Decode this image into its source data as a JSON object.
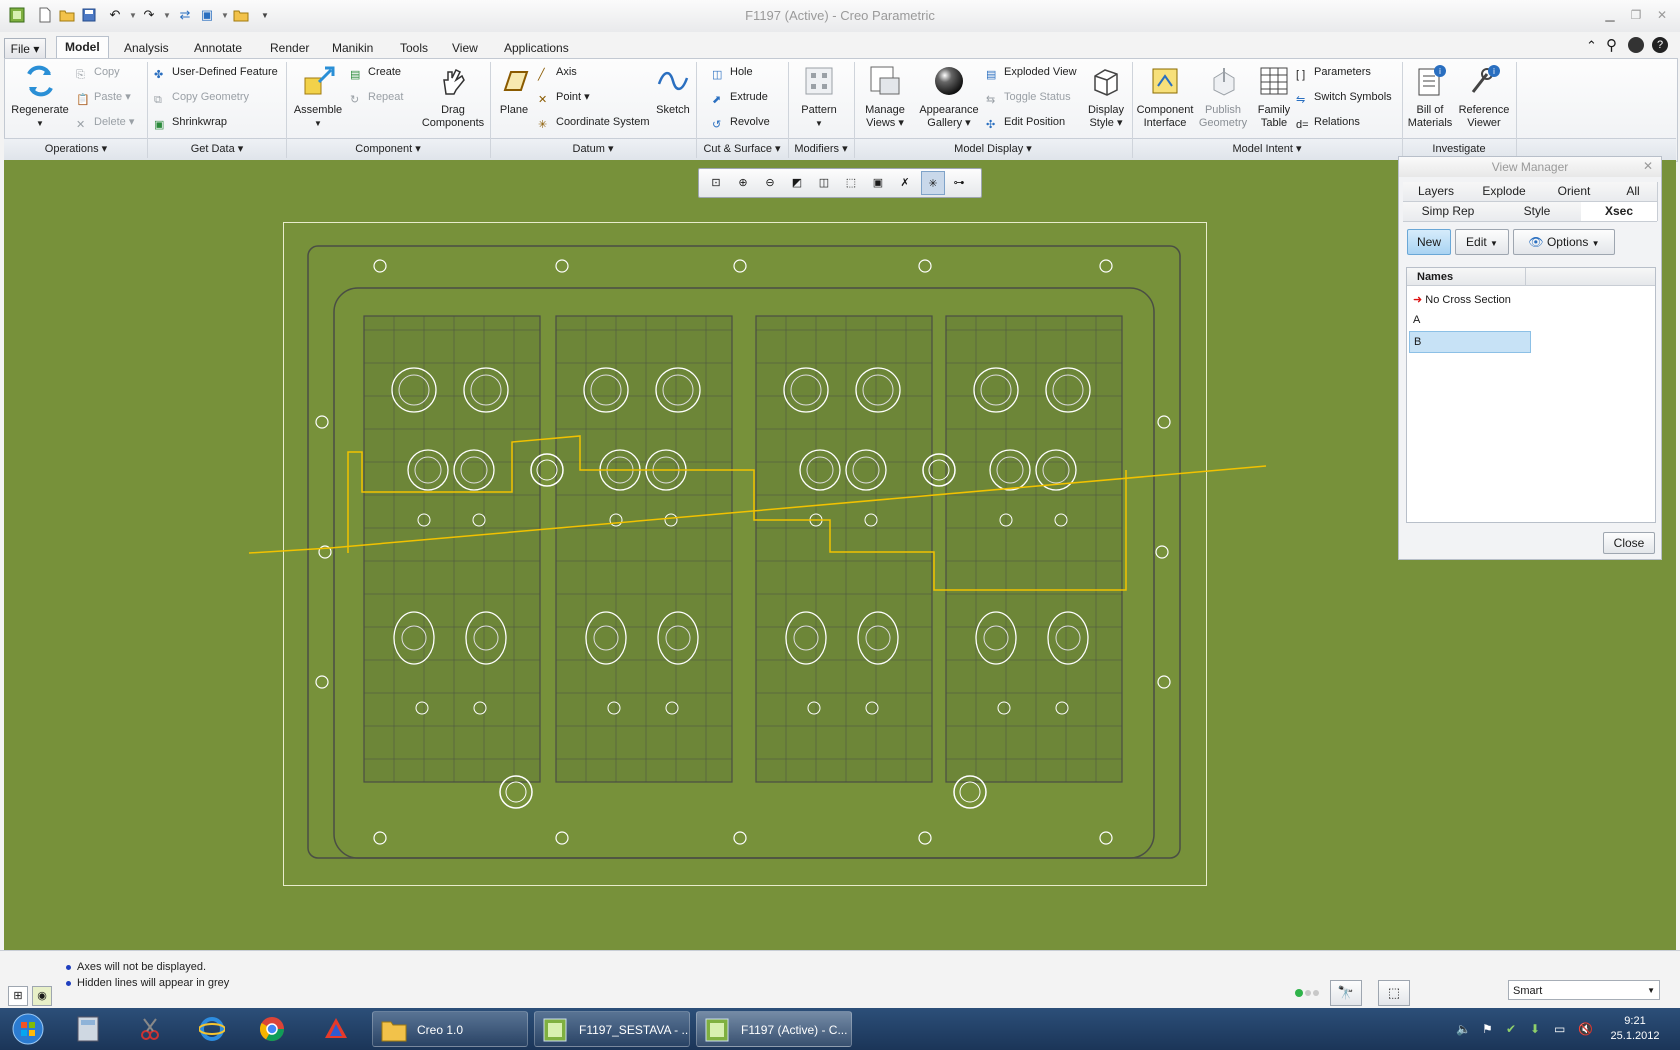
{
  "window": {
    "title": "F1197 (Active) - Creo Parametric"
  },
  "tabs": [
    "File",
    "Model",
    "Analysis",
    "Annotate",
    "Render",
    "Manikin",
    "Tools",
    "View",
    "Applications"
  ],
  "active_tab": "Model",
  "ribbon": {
    "regenerate": "Regenerate",
    "copy": "Copy",
    "paste": "Paste",
    "delete": "Delete",
    "user_defined_feature": "User-Defined Feature",
    "copy_geometry": "Copy Geometry",
    "shrinkwrap": "Shrinkwrap",
    "assemble": "Assemble",
    "create": "Create",
    "repeat": "Repeat",
    "drag_components_1": "Drag",
    "drag_components_2": "Components",
    "plane": "Plane",
    "axis": "Axis",
    "point": "Point",
    "coordinate_system": "Coordinate System",
    "sketch": "Sketch",
    "hole": "Hole",
    "extrude": "Extrude",
    "revolve": "Revolve",
    "pattern": "Pattern",
    "manage_views_1": "Manage",
    "manage_views_2": "Views",
    "appearance_gallery_1": "Appearance",
    "appearance_gallery_2": "Gallery",
    "exploded_view": "Exploded View",
    "toggle_status": "Toggle Status",
    "edit_position": "Edit Position",
    "display_style_1": "Display",
    "display_style_2": "Style",
    "component_interface_1": "Component",
    "component_interface_2": "Interface",
    "publish_geometry_1": "Publish",
    "publish_geometry_2": "Geometry",
    "family_table_1": "Family",
    "family_table_2": "Table",
    "parameters": "Parameters",
    "switch_symbols": "Switch Symbols",
    "relations": "Relations",
    "bill_of_materials_1": "Bill of",
    "bill_of_materials_2": "Materials",
    "reference_viewer_1": "Reference",
    "reference_viewer_2": "Viewer"
  },
  "groups": [
    "Operations",
    "Get Data",
    "Component",
    "Datum",
    "Cut & Surface",
    "Modifiers",
    "Model Display",
    "Model Intent",
    "Investigate"
  ],
  "view_manager": {
    "title": "View Manager",
    "tabs_row1": [
      "Layers",
      "Explode",
      "Orient",
      "All"
    ],
    "tabs_row2": [
      "Simp Rep",
      "Style",
      "Xsec"
    ],
    "active_tab": "Xsec",
    "new": "New",
    "edit": "Edit",
    "options": "Options",
    "names_header": "Names",
    "items": [
      "No Cross Section",
      "A",
      "B"
    ],
    "selected": "B",
    "close": "Close"
  },
  "messages": [
    "Axes will not be displayed.",
    "Hidden lines will appear in grey"
  ],
  "filter": {
    "value": "Smart"
  },
  "taskbar": {
    "items": [
      "Creo 1.0",
      "F1197_SESTAVA - ...",
      "F1197 (Active) - C..."
    ],
    "time": "9:21",
    "date": "25.1.2012"
  },
  "colors": {
    "canvas": "#77913a",
    "section_line": "#f2c200",
    "accent": "#2a6fc0"
  }
}
